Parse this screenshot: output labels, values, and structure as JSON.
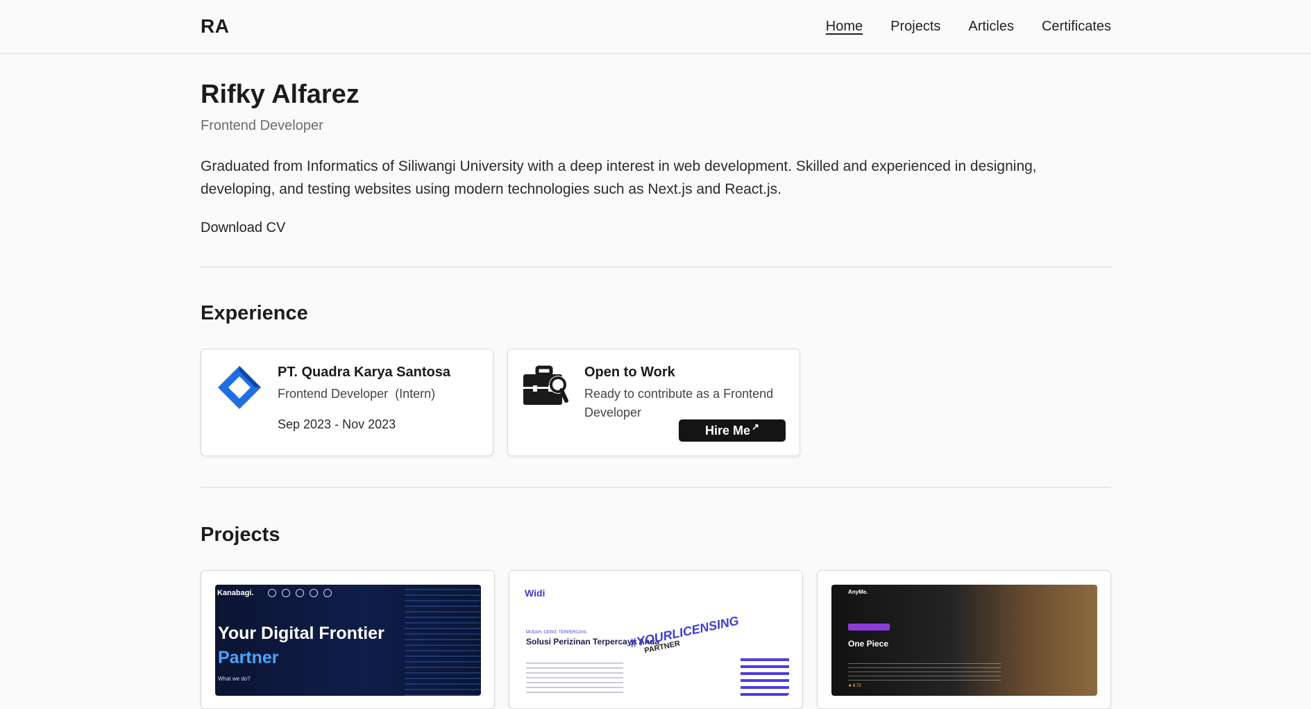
{
  "nav": {
    "logo": "RA",
    "links": [
      "Home",
      "Projects",
      "Articles",
      "Certificates"
    ],
    "active": "Home"
  },
  "hero": {
    "name": "Rifky Alfarez",
    "role": "Frontend Developer",
    "bio": "Graduated from Informatics of Siliwangi University with a deep interest in web development. Skilled and experienced in designing, developing, and testing websites using modern technologies such as Next.js and React.js.",
    "cv_label": "Download CV"
  },
  "experience": {
    "title": "Experience",
    "job": {
      "company": "PT. Quadra Karya Santosa",
      "position": "Frontend Developer",
      "type": "(Intern)",
      "period": "Sep 2023 - Nov 2023"
    },
    "open": {
      "title": "Open to Work",
      "desc": "Ready to contribute as a Frontend Developer",
      "button": "Hire Me"
    }
  },
  "projects": {
    "title": "Projects",
    "items": [
      {
        "brand": "Kanabagi.",
        "headline_1": "Your Digital Frontier",
        "headline_2": "Partner",
        "sub": "What we do?"
      },
      {
        "brand": "Widi",
        "tagline": "MUDAH, CEPAT, TERPERCAYA",
        "headline": "Solusi Perizinan Terpercaya Anda",
        "hashtag": "#YOURLICENSING",
        "partner": "PARTNER"
      },
      {
        "brand": "AnyMe.",
        "headline": "One Piece",
        "rating": "★ 8.72"
      }
    ]
  },
  "colors": {
    "accent_blue": "#1f6fe0",
    "button_bg": "#141414",
    "background": "#fafafa"
  }
}
